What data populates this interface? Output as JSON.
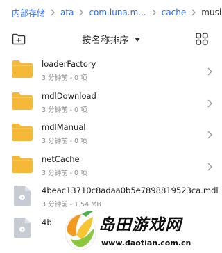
{
  "breadcrumb": {
    "items": [
      "内部存储",
      "ata",
      "com.luna.m...",
      "cache",
      "music"
    ]
  },
  "toolbar": {
    "sort_label": "按名称排序"
  },
  "files": [
    {
      "name": "loaderFactory",
      "meta": "3 分钟前 - 0 项",
      "type": "folder"
    },
    {
      "name": "mdlDownload",
      "meta": "3 分钟前 - 0 项",
      "type": "folder"
    },
    {
      "name": "mdlManual",
      "meta": "3 分钟前 - 0 项",
      "type": "folder"
    },
    {
      "name": "netCache",
      "meta": "3 分钟前 - 0 项",
      "type": "folder"
    },
    {
      "name": "4beac13710c8adaa0b5e7898819523ca.mdl",
      "meta": "3 分钟前 - 1.54 MB",
      "type": "file"
    },
    {
      "name": "4b",
      "meta": "",
      "type": "file"
    }
  ],
  "watermark": {
    "title": "岛田游戏网",
    "url": "www.daotian.com.cn"
  },
  "colors": {
    "accent": "#2d6fe0",
    "folder": "#f5b937",
    "file_icon": "#c7ccd4"
  },
  "icons": [
    "new-folder-icon",
    "chevron-right-icon",
    "grid-view-icon",
    "folder-icon",
    "file-icon"
  ]
}
